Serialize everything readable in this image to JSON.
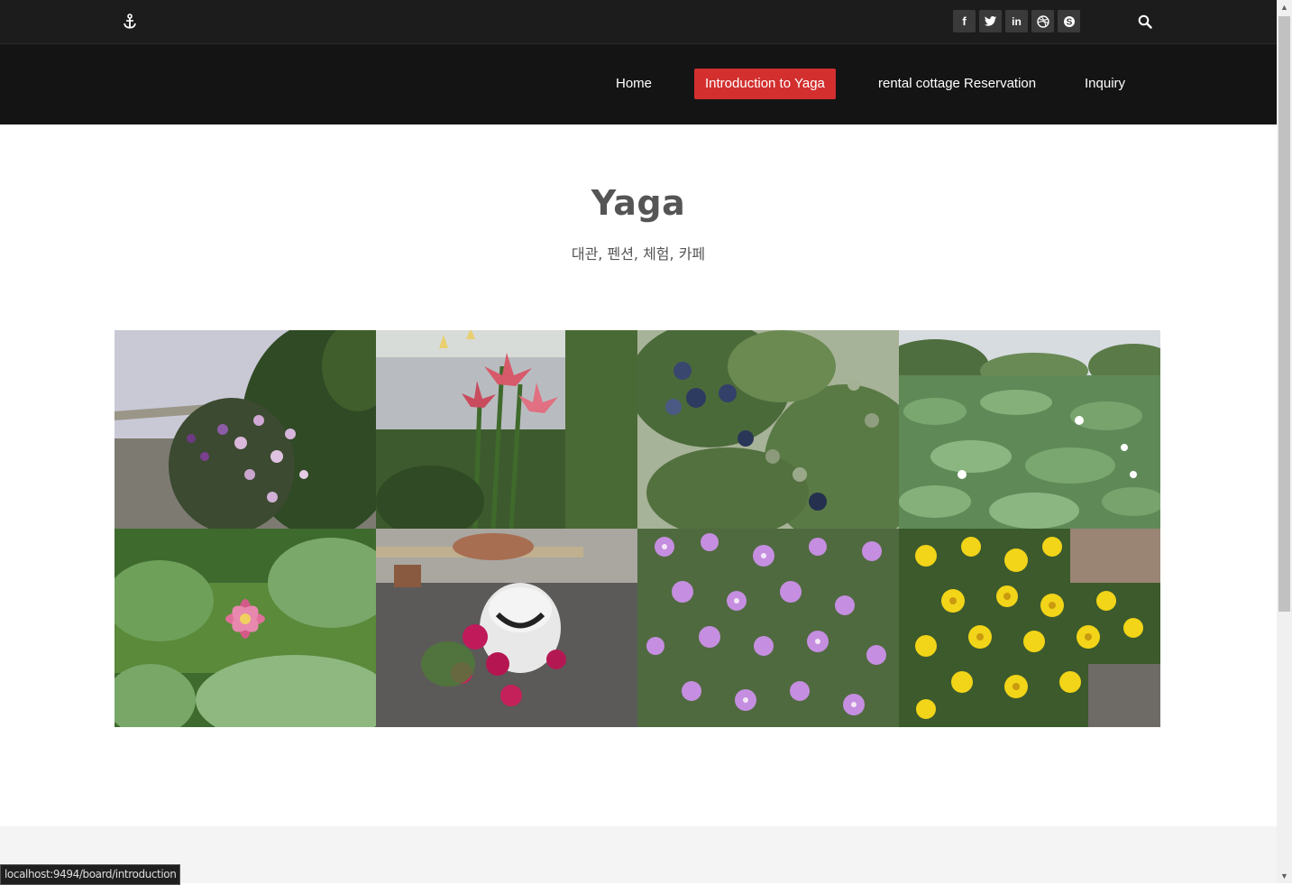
{
  "topbar": {
    "logo_icon": "anchor-icon",
    "social": [
      {
        "icon": "facebook-icon",
        "glyph": "f"
      },
      {
        "icon": "twitter-icon",
        "glyph": "t"
      },
      {
        "icon": "linkedin-icon",
        "glyph": "in"
      },
      {
        "icon": "dribbble-icon",
        "glyph": "◎"
      },
      {
        "icon": "skype-icon",
        "glyph": "S"
      }
    ],
    "search_icon": "search-icon"
  },
  "nav": {
    "items": [
      {
        "label": "Home"
      },
      {
        "label": "Introduction to Yaga",
        "active": true
      },
      {
        "label": "rental cottage Reservation"
      },
      {
        "label": "Inquiry"
      }
    ],
    "active_color": "#d32f2f"
  },
  "main": {
    "title": "Yaga",
    "subtitle": "대관, 펜션, 체험, 카페"
  },
  "gallery": {
    "photos": [
      "clematis-flowers-photo",
      "lily-flowers-photo",
      "blueberry-bush-photo",
      "lotus-pond-photo",
      "water-lily-photo",
      "petunia-frog-pot-photo",
      "purple-ice-plant-flowers-photo",
      "yellow-daisy-flowers-photo"
    ]
  },
  "status_bar": {
    "url": "localhost:9494/board/introduction"
  }
}
